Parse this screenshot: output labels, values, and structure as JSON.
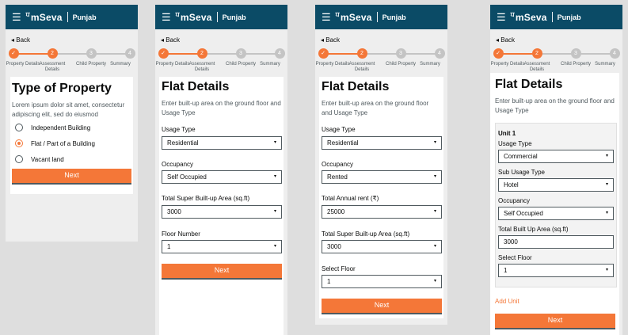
{
  "app": {
    "brand": "mSeva",
    "brand_prefix": "ਧ",
    "city": "Punjab",
    "menu_icon": "hamburger-icon"
  },
  "common": {
    "back": "Back",
    "steps": [
      {
        "num": "1",
        "label": "Property Details",
        "state": "done"
      },
      {
        "num": "2",
        "label": "Assessment Details",
        "state": "active"
      },
      {
        "num": "3",
        "label": "Child Property",
        "state": "todo"
      },
      {
        "num": "4",
        "label": "Summary",
        "state": "todo"
      }
    ],
    "check": "✓",
    "next_label": "Next",
    "chevron": "▾"
  },
  "screen1": {
    "title": "Type of Property",
    "desc": "Lorem ipsum dolor sit amet, consectetur adipiscing elit, sed do eiusmod",
    "options": [
      {
        "label": "Independent Building",
        "selected": false
      },
      {
        "label": "Flat / Part of a Building",
        "selected": true
      },
      {
        "label": "Vacant land",
        "selected": false
      }
    ]
  },
  "screen2": {
    "title": "Flat Details",
    "desc": "Enter built-up area on the ground floor and Usage Type",
    "usage_label": "Usage Type",
    "usage_value": "Residential",
    "occupancy_label": "Occupancy",
    "occupancy_value": "Self Occupied",
    "area_label": "Total Super Built-up Area (sq.ft)",
    "area_value": "3000",
    "floor_label": "Floor Number",
    "floor_value": "1"
  },
  "screen3": {
    "title": "Flat Details",
    "desc": "Enter built-up area on the ground floor and Usage Type",
    "usage_label": "Usage Type",
    "usage_value": "Residential",
    "occupancy_label": "Occupancy",
    "occupancy_value": "Rented",
    "rent_label": "Total Annual rent (₹)",
    "rent_value": "25000",
    "area_label": "Total Super Built-up Area (sq.ft)",
    "area_value": "3000",
    "floor_label": "Select Floor",
    "floor_value": "1"
  },
  "screen4": {
    "title": "Flat Details",
    "desc": "Enter built-up area on the ground floor and Usage Type",
    "unit_title": "Unit 1",
    "usage_label": "Usage Type",
    "usage_value": "Commercial",
    "subusage_label": "Sub Usage Type",
    "subusage_value": "Hotel",
    "occupancy_label": "Occupancy",
    "occupancy_value": "Self Occupied",
    "builtup_label": "Total Built Up Area (sq.ft)",
    "builtup_value": "3000",
    "floor_label": "Select Floor",
    "floor_value": "1",
    "add_unit": "Add Unit"
  }
}
